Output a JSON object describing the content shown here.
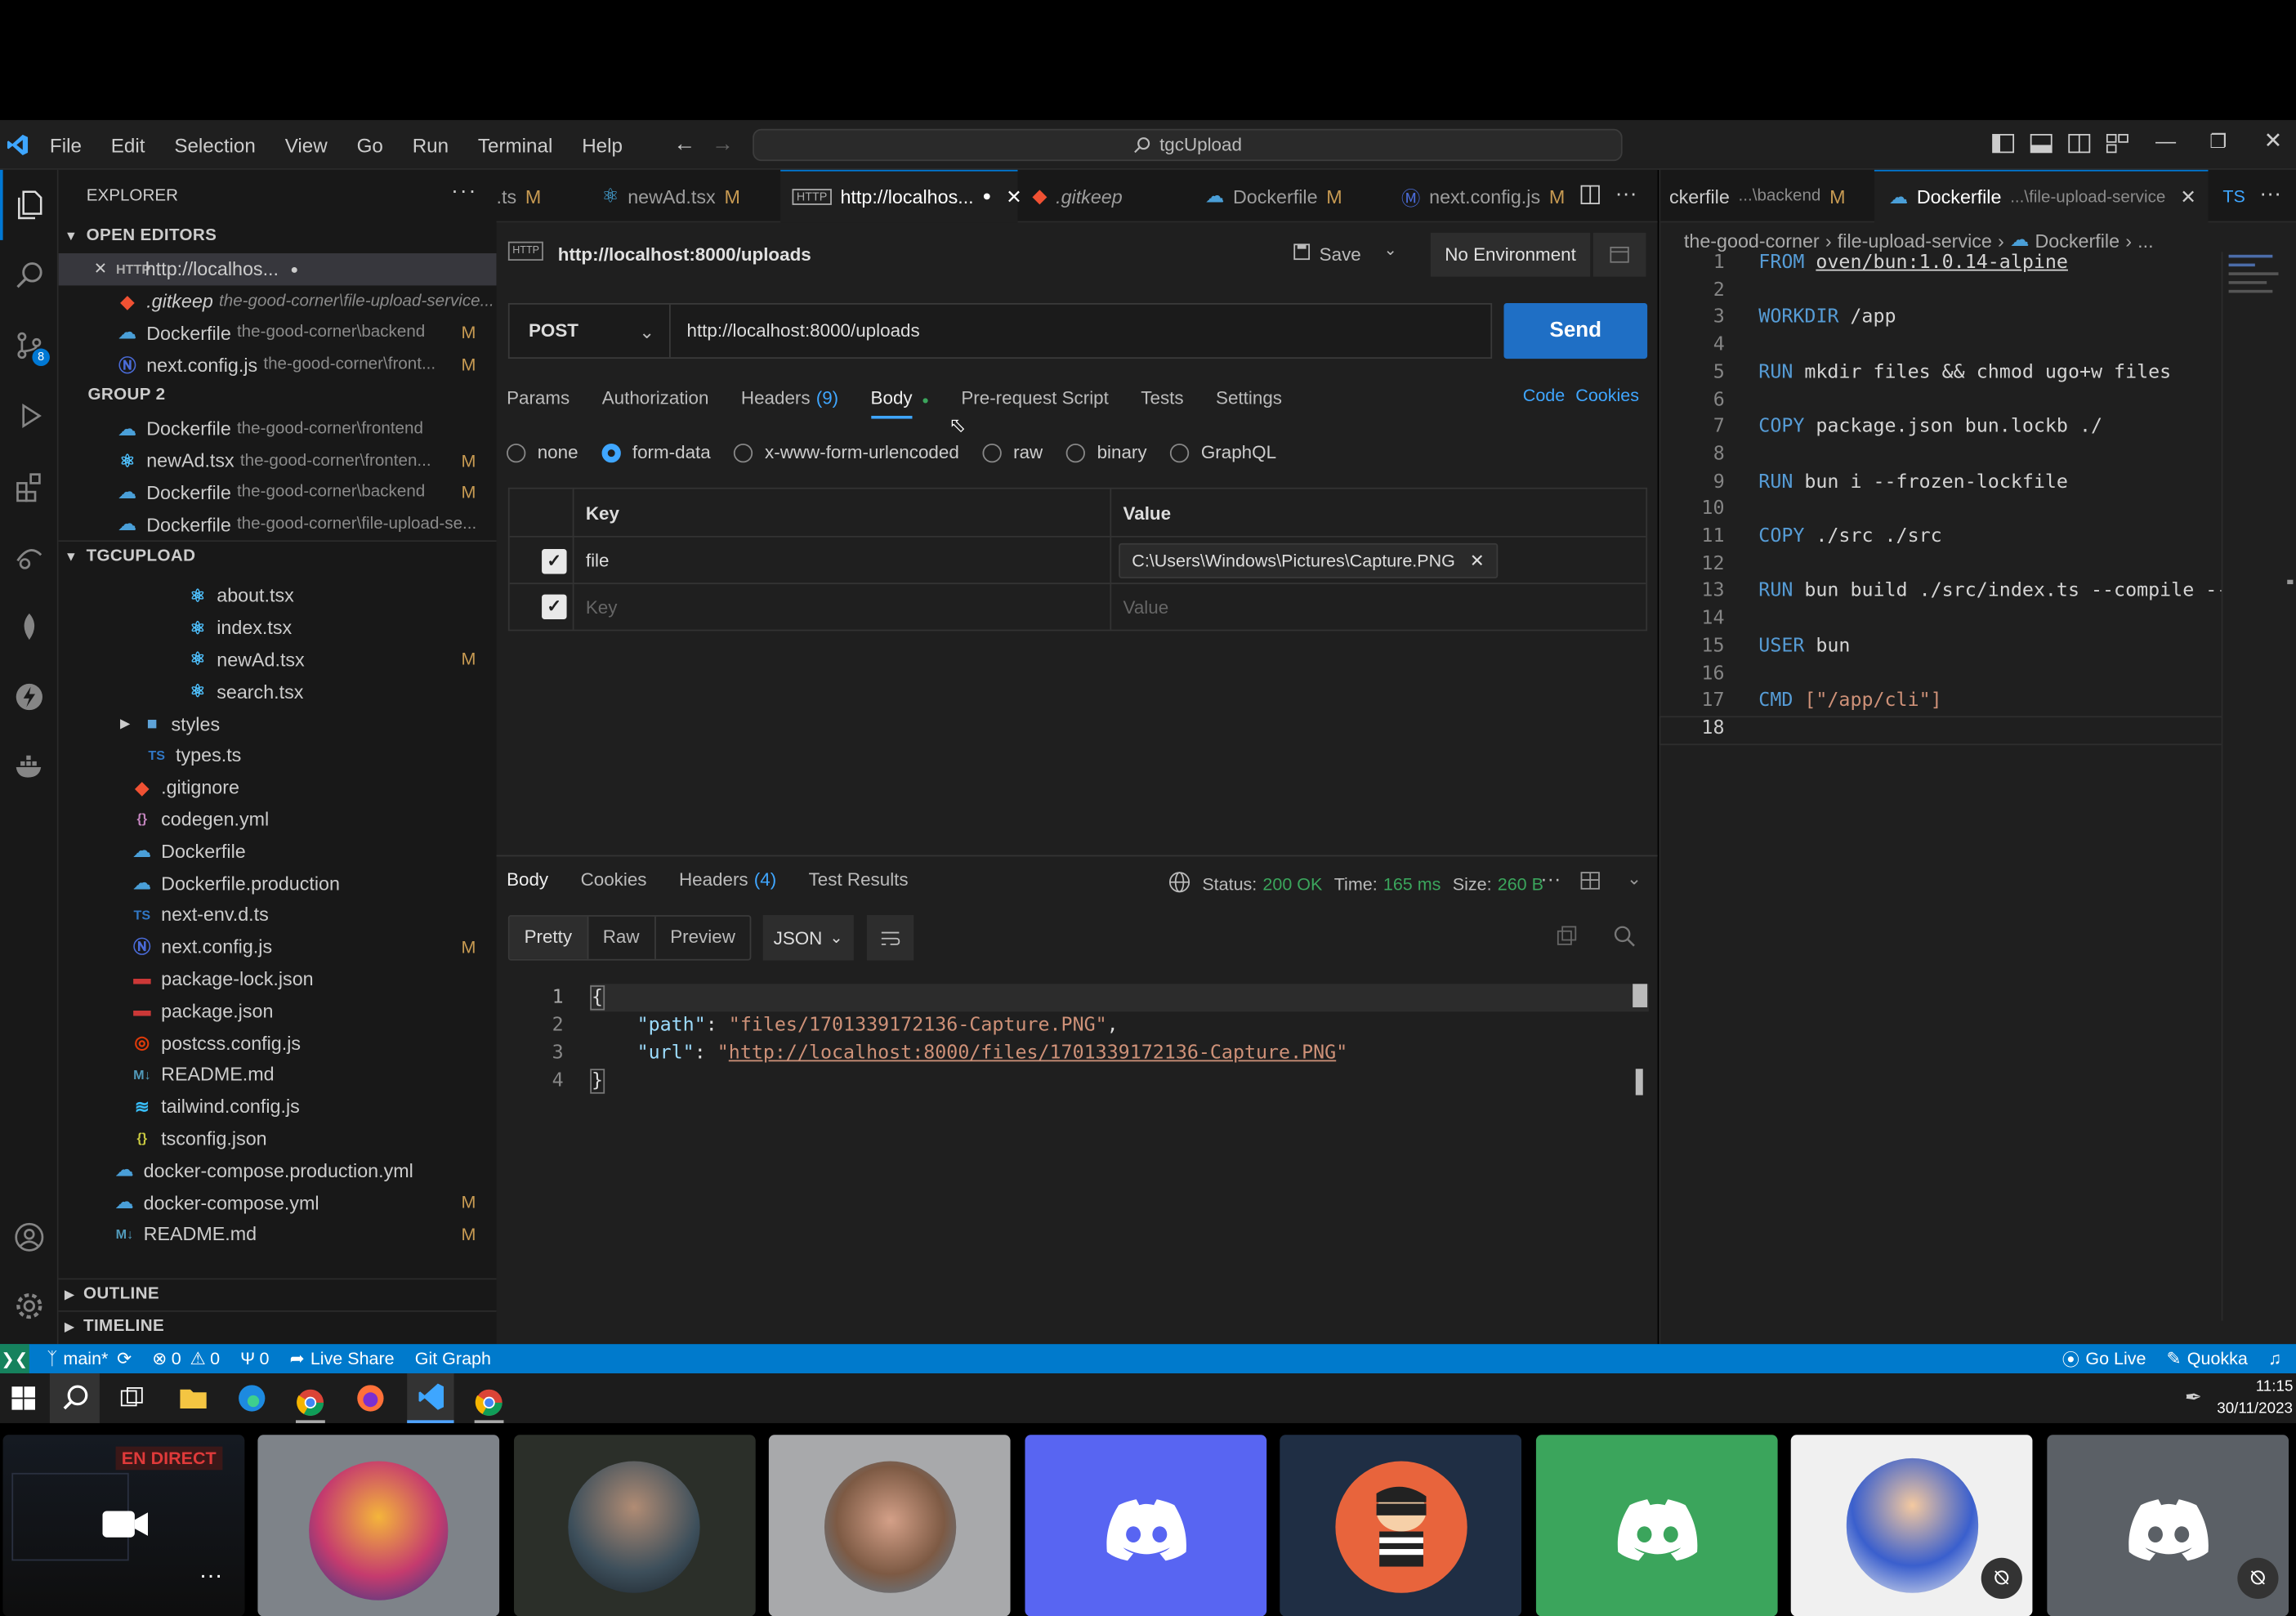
{
  "menu": [
    "File",
    "Edit",
    "Selection",
    "View",
    "Go",
    "Run",
    "Terminal",
    "Help"
  ],
  "command_center": "tgcUpload",
  "explorer": {
    "title": "EXPLORER",
    "open_editors_label": "OPEN EDITORS",
    "open_editors": [
      {
        "name": "http://localhos...",
        "path": "",
        "mark": ""
      },
      {
        "name": ".gitkeep",
        "path": "the-good-corner\\file-upload-service...",
        "mark": ""
      },
      {
        "name": "Dockerfile",
        "path": "the-good-corner\\backend",
        "mark": "M"
      },
      {
        "name": "next.config.js",
        "path": "the-good-corner\\front...",
        "mark": "M"
      }
    ],
    "group2_label": "GROUP 2",
    "group2": [
      {
        "name": "Dockerfile",
        "path": "the-good-corner\\frontend",
        "mark": ""
      },
      {
        "name": "newAd.tsx",
        "path": "the-good-corner\\fronten...",
        "mark": "M"
      },
      {
        "name": "Dockerfile",
        "path": "the-good-corner\\backend",
        "mark": "M"
      },
      {
        "name": "Dockerfile",
        "path": "the-good-corner\\file-upload-se...",
        "mark": ""
      }
    ],
    "project_label": "TGCUPLOAD",
    "tree": [
      {
        "name": "about.tsx",
        "mark": ""
      },
      {
        "name": "index.tsx",
        "mark": ""
      },
      {
        "name": "newAd.tsx",
        "mark": "M"
      },
      {
        "name": "search.tsx",
        "mark": ""
      },
      {
        "name": "styles",
        "mark": ""
      },
      {
        "name": "types.ts",
        "mark": ""
      },
      {
        "name": ".gitignore",
        "mark": ""
      },
      {
        "name": "codegen.yml",
        "mark": ""
      },
      {
        "name": "Dockerfile",
        "mark": ""
      },
      {
        "name": "Dockerfile.production",
        "mark": ""
      },
      {
        "name": "next-env.d.ts",
        "mark": ""
      },
      {
        "name": "next.config.js",
        "mark": "M"
      },
      {
        "name": "package-lock.json",
        "mark": ""
      },
      {
        "name": "package.json",
        "mark": ""
      },
      {
        "name": "postcss.config.js",
        "mark": ""
      },
      {
        "name": "README.md",
        "mark": ""
      },
      {
        "name": "tailwind.config.js",
        "mark": ""
      },
      {
        "name": "tsconfig.json",
        "mark": ""
      },
      {
        "name": "docker-compose.production.yml",
        "mark": ""
      },
      {
        "name": "docker-compose.yml",
        "mark": "M"
      },
      {
        "name": "README.md",
        "mark": "M"
      }
    ],
    "outline_label": "OUTLINE",
    "timeline_label": "TIMELINE"
  },
  "tabs": [
    {
      "label": ".ts",
      "mark": "M"
    },
    {
      "label": "newAd.tsx",
      "mark": "M"
    },
    {
      "label": "http://localhos...",
      "mark": ""
    },
    {
      "label": ".gitkeep",
      "mark": ""
    },
    {
      "label": "Dockerfile",
      "mark": "M"
    },
    {
      "label": "next.config.js",
      "mark": "M"
    }
  ],
  "right_tabs": [
    {
      "label": "ckerfile",
      "path": "...\\backend",
      "mark": "M"
    },
    {
      "label": "Dockerfile",
      "path": "...\\file-upload-service",
      "mark": ""
    },
    {
      "label": "TS",
      "path": "",
      "mark": ""
    }
  ],
  "request": {
    "badge": "HTTP",
    "title": "http://localhost:8000/uploads",
    "save_label": "Save",
    "environment": "No Environment",
    "method": "POST",
    "url": "http://localhost:8000/uploads",
    "send_label": "Send",
    "tabs": [
      "Params",
      "Authorization",
      "Headers",
      "Body",
      "Pre-request Script",
      "Tests",
      "Settings"
    ],
    "headers_count": "(9)",
    "code_link": "Code",
    "cookies_link": "Cookies",
    "body_types": [
      "none",
      "form-data",
      "x-www-form-urlencoded",
      "raw",
      "binary",
      "GraphQL"
    ],
    "form_headers": {
      "key": "Key",
      "value": "Value"
    },
    "form_rows": [
      {
        "key": "file",
        "value": "C:\\Users\\Windows\\Pictures\\Capture.PNG"
      },
      {
        "key": "Key",
        "value": "Value"
      }
    ]
  },
  "response": {
    "tabs": [
      "Body",
      "Cookies",
      "Headers",
      "Test Results"
    ],
    "headers_count": "(4)",
    "status_label": "Status:",
    "status_value": "200 OK",
    "time_label": "Time:",
    "time_value": "165 ms",
    "size_label": "Size:",
    "size_value": "260 B",
    "view_modes": [
      "Pretty",
      "Raw",
      "Preview"
    ],
    "format": "JSON",
    "lines": [
      "{",
      "\"path\": \"files/1701339172136-Capture.PNG\",",
      "\"url\": \"http://localhost:8000/files/1701339172136-Capture.PNG\"",
      "}"
    ],
    "path_key": "\"path\"",
    "path_val": "\"files/1701339172136-Capture.PNG\"",
    "url_key": "\"url\"",
    "url_val": "http://localhost:8000/files/1701339172136-Capture.PNG"
  },
  "breadcrumb": [
    "the-good-corner",
    "file-upload-service",
    "Dockerfile",
    "..."
  ],
  "dockerfile": [
    {
      "n": "1",
      "kw": "FROM",
      "rest": "oven/bun:1.0.14-alpine"
    },
    {
      "n": "2",
      "kw": "",
      "rest": ""
    },
    {
      "n": "3",
      "kw": "WORKDIR",
      "rest": "/app"
    },
    {
      "n": "4",
      "kw": "",
      "rest": ""
    },
    {
      "n": "5",
      "kw": "RUN",
      "rest": "mkdir files && chmod ugo+w files"
    },
    {
      "n": "6",
      "kw": "",
      "rest": ""
    },
    {
      "n": "7",
      "kw": "COPY",
      "rest": "package.json bun.lockb ./"
    },
    {
      "n": "8",
      "kw": "",
      "rest": ""
    },
    {
      "n": "9",
      "kw": "RUN",
      "rest": "bun i --frozen-lockfile"
    },
    {
      "n": "10",
      "kw": "",
      "rest": ""
    },
    {
      "n": "11",
      "kw": "COPY",
      "rest": "./src ./src"
    },
    {
      "n": "12",
      "kw": "",
      "rest": ""
    },
    {
      "n": "13",
      "kw": "RUN",
      "rest": "bun build ./src/index.ts --compile --o"
    },
    {
      "n": "14",
      "kw": "",
      "rest": ""
    },
    {
      "n": "15",
      "kw": "USER",
      "rest": "bun"
    },
    {
      "n": "16",
      "kw": "",
      "rest": ""
    },
    {
      "n": "17",
      "kw": "CMD",
      "rest": "[\"/app/cli\"]"
    },
    {
      "n": "18",
      "kw": "",
      "rest": ""
    }
  ],
  "statusbar": {
    "branch": "main*",
    "errors": "0",
    "warnings": "0",
    "ports": "0",
    "live_share": "Live Share",
    "git_graph": "Git Graph",
    "go_live": "Go Live",
    "quokka": "Quokka"
  },
  "taskbar": {
    "time": "11:15",
    "date": "30/11/2023"
  },
  "call": {
    "live_badge": "EN DIRECT"
  },
  "colors": {
    "accent": "#0e639c",
    "send": "#1f6fc5",
    "statusbar": "#007acc",
    "discord": "#5865f2",
    "discord_green": "#3ba55c"
  }
}
